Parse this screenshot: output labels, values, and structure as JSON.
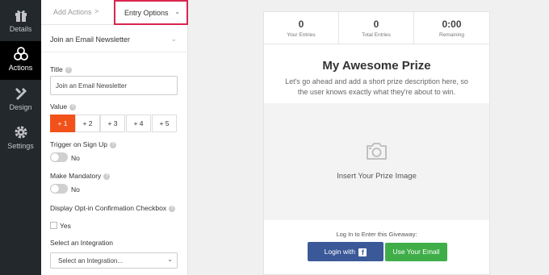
{
  "nav": {
    "items": [
      {
        "label": "Details",
        "icon": "gift-icon"
      },
      {
        "label": "Actions",
        "icon": "actions-icon",
        "active": true
      },
      {
        "label": "Design",
        "icon": "design-icon"
      },
      {
        "label": "Settings",
        "icon": "gear-icon"
      }
    ]
  },
  "panel": {
    "breadcrumb": {
      "add_actions": "Add Actions",
      "separator": ">",
      "entry_options": "Entry Options"
    },
    "section_title": "Join an Email Newsletter",
    "title_label": "Title",
    "title_value": "Join an Email Newsletter",
    "value_label": "Value",
    "value_options": [
      "+ 1",
      "+ 2",
      "+ 3",
      "+ 4",
      "+ 5"
    ],
    "value_selected": "+ 1",
    "trigger_label": "Trigger on Sign Up",
    "trigger_state": "No",
    "mandatory_label": "Make Mandatory",
    "mandatory_state": "No",
    "optin_label": "Display Opt-in Confirmation Checkbox",
    "optin_state": "Yes",
    "integration_label": "Select an Integration",
    "integration_value": "Select an Integration..."
  },
  "preview": {
    "stats": [
      {
        "value": "0",
        "caption": "Your Entries"
      },
      {
        "value": "0",
        "caption": "Total Entries"
      },
      {
        "value": "0:00",
        "caption": "Remaining"
      }
    ],
    "prize_title": "My Awesome Prize",
    "prize_description": "Let's go ahead and add a short prize description here, so the user knows exactly what they're about to win.",
    "image_placeholder": "Insert Your Prize Image",
    "login_prompt": "Log In to Enter this Giveaway:",
    "login_facebook": "Login with",
    "use_email": "Use Your Email"
  },
  "colors": {
    "nav_bg": "#23282d",
    "active_value": "#f2521a",
    "highlight_border": "#d9264f",
    "facebook": "#3b5998",
    "email_button": "#3fae49"
  }
}
